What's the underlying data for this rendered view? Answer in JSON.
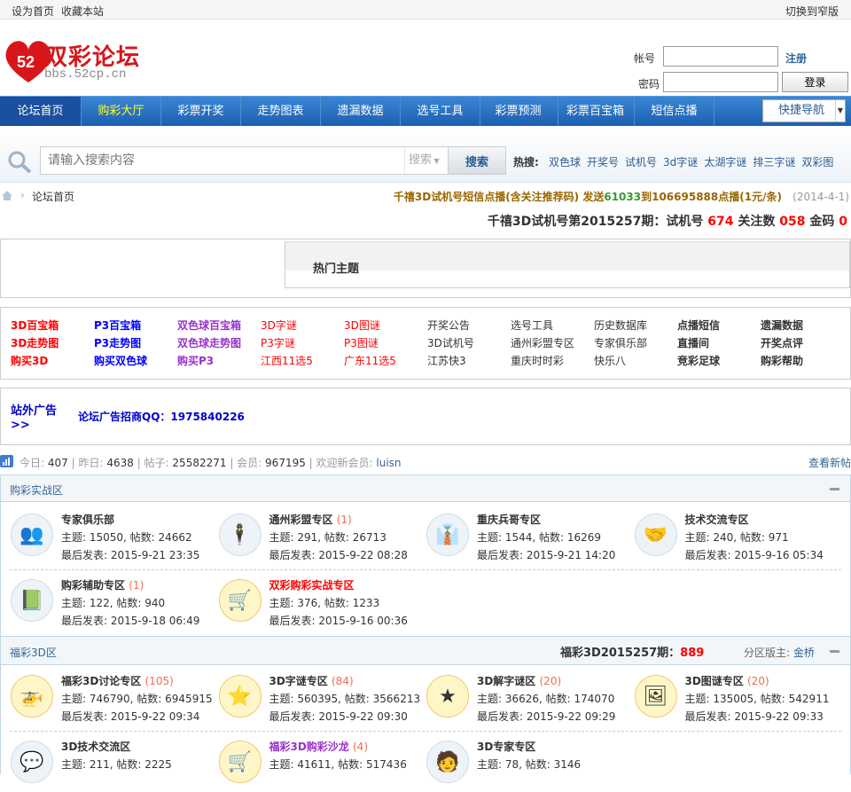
{
  "topbar": {
    "set_home": "设为首页",
    "bookmark": "收藏本站",
    "switch_width": "切换到窄版"
  },
  "logo": {
    "text": "双彩论坛",
    "url_text": "bbs.52cp.cn",
    "badge": "52"
  },
  "login": {
    "account_label": "帐号",
    "password_label": "密码",
    "register": "注册",
    "login_button": "登录",
    "account_value": "",
    "password_value": ""
  },
  "nav": {
    "items": [
      "论坛首页",
      "购彩大厅",
      "彩票开奖",
      "走势图表",
      "遗漏数据",
      "选号工具",
      "彩票预测",
      "彩票百宝箱",
      "短信点播"
    ],
    "quick_nav": "快捷导航"
  },
  "search": {
    "placeholder": "请输入搜索内容",
    "type": "搜索",
    "button": "搜索",
    "hot_label": "热搜:",
    "hot": [
      "双色球",
      "开奖号",
      "试机号",
      "3d字谜",
      "太湖字谜",
      "排三字谜",
      "双彩图"
    ]
  },
  "breadcrumb": {
    "home": "论坛首页"
  },
  "notice": {
    "part1": "千禧3D试机号短信点播(含关注推荐码) 发送",
    "code": "61033",
    "part2": "到106695888点播(1元/条)",
    "date": "(2014-4-1)"
  },
  "trial": {
    "prefix": "千禧3D试机号第2015257期：试机号 ",
    "trial": "674",
    "follow_label": " 关注数 ",
    "follow": "058",
    "gold_label": " 金码 ",
    "gold": "0"
  },
  "hot_topics": {
    "title": "热门主题"
  },
  "links": {
    "columns": [
      {
        "color": "#ff0000",
        "bold": true,
        "items": [
          "3D百宝箱",
          "3D走势图",
          "购买3D"
        ]
      },
      {
        "color": "#0000ff",
        "bold": true,
        "items": [
          "P3百宝箱",
          "P3走势图",
          "购买双色球"
        ]
      },
      {
        "color": "#9932cc",
        "bold": true,
        "items": [
          "双色球百宝箱",
          "双色球走势图",
          "购买P3"
        ]
      },
      {
        "color": "#ff0000",
        "bold": false,
        "items": [
          "3D字谜",
          "P3字谜",
          "江西11选5"
        ]
      },
      {
        "color": "#ff0000",
        "bold": false,
        "items": [
          "3D图谜",
          "P3图谜",
          "广东11选5"
        ]
      },
      {
        "color": "#333333",
        "bold": false,
        "items": [
          "开奖公告",
          "3D试机号",
          "江苏快3"
        ]
      },
      {
        "color": "#333333",
        "bold": false,
        "items": [
          "选号工具",
          "通州彩盟专区",
          "重庆时时彩"
        ]
      },
      {
        "color": "#333333",
        "bold": false,
        "items": [
          "历史数据库",
          "专家俱乐部",
          "快乐八"
        ]
      },
      {
        "color": "#333333",
        "bold": true,
        "items": [
          "点播短信",
          "直播间",
          "竞彩足球"
        ]
      },
      {
        "color": "#333333",
        "bold": true,
        "items": [
          "遗漏数据",
          "开奖点评",
          "购彩帮助"
        ]
      }
    ]
  },
  "ad": {
    "label1": "站外广告",
    "label2": ">>",
    "text": "论坛广告招商QQ：1975840226"
  },
  "stats": {
    "today_label": "今日:",
    "today": "407",
    "yesterday_label": "昨日:",
    "yesterday": "4638",
    "posts_label": "帖子:",
    "posts": "25582271",
    "members_label": "会员:",
    "members": "967195",
    "newest_label": "欢迎新会员:",
    "newest": "luisn",
    "view_new": "查看新帖"
  },
  "sections": [
    {
      "title": "购彩实战区",
      "forums": [
        {
          "name": "专家俱乐部",
          "count": "",
          "icon": "👥",
          "bg": "#eef3f7",
          "topics": "主题: 15050, 帖数: 24662",
          "last": "最后发表: 2015-9-21 23:35"
        },
        {
          "name": "通州彩盟专区",
          "count": "(1)",
          "icon": "🕴",
          "bg": "#eef3f7",
          "topics": "主题: 291, 帖数: 26713",
          "last": "最后发表: 2015-9-22 08:28"
        },
        {
          "name": "重庆兵哥专区",
          "count": "",
          "icon": "👔",
          "bg": "#eef3f7",
          "topics": "主题: 1544, 帖数: 16269",
          "last": "最后发表: 2015-9-21 14:20"
        },
        {
          "name": "技术交流专区",
          "count": "",
          "icon": "🤝",
          "bg": "#eef3f7",
          "topics": "主题: 240, 帖数: 971",
          "last": "最后发表: 2015-9-16 05:34"
        },
        {
          "name": "购彩辅助专区",
          "count": "(1)",
          "icon": "📗",
          "bg": "#eef3f7",
          "topics": "主题: 122, 帖数: 940",
          "last": "最后发表: 2015-9-18 06:49"
        },
        {
          "name": "双彩购彩实战专区",
          "count": "",
          "icon": "🛒",
          "bg": "#fff6c8",
          "red": true,
          "topics": "主题: 376, 帖数: 1233",
          "last": "最后发表: 2015-9-16 00:36"
        }
      ]
    },
    {
      "title": "福彩3D区",
      "draw_label": "福彩3D2015257期：",
      "draw": "889",
      "mod_label": "分区版主:",
      "mod": "金桥",
      "forums": [
        {
          "name": "福彩3D讨论专区",
          "count": "(105)",
          "icon": "🚁",
          "bg": "#fff6c8",
          "topics": "主题: 746790, 帖数: 6945915",
          "last": "最后发表: 2015-9-22 09:34"
        },
        {
          "name": "3D字谜专区",
          "count": "(84)",
          "icon": "⭐",
          "bg": "#fff6c8",
          "topics": "主题: 560395, 帖数: 3566213",
          "last": "最后发表: 2015-9-22 09:30"
        },
        {
          "name": "3D解字谜区",
          "count": "(20)",
          "icon": "★",
          "bg": "#fff6c8",
          "topics": "主题: 36626, 帖数: 174070",
          "last": "最后发表: 2015-9-22 09:29"
        },
        {
          "name": "3D图谜专区",
          "count": "(20)",
          "icon": "🖼",
          "bg": "#fff6c8",
          "topics": "主题: 135005, 帖数: 542911",
          "last": "最后发表: 2015-9-22 09:33"
        },
        {
          "name": "3D技术交流区",
          "count": "",
          "icon": "💬",
          "bg": "#eef3f7",
          "topics": "主题: 211, 帖数: 2225",
          "last": ""
        },
        {
          "name": "福彩3D购彩沙龙",
          "count": "(4)",
          "icon": "🛒",
          "bg": "#fff6c8",
          "purple": true,
          "topics": "主题: 41611, 帖数: 517436",
          "last": ""
        },
        {
          "name": "3D专家专区",
          "count": "",
          "icon": "🧑",
          "bg": "#eef3f7",
          "topics": "主题: 78, 帖数: 3146",
          "last": ""
        }
      ]
    }
  ]
}
